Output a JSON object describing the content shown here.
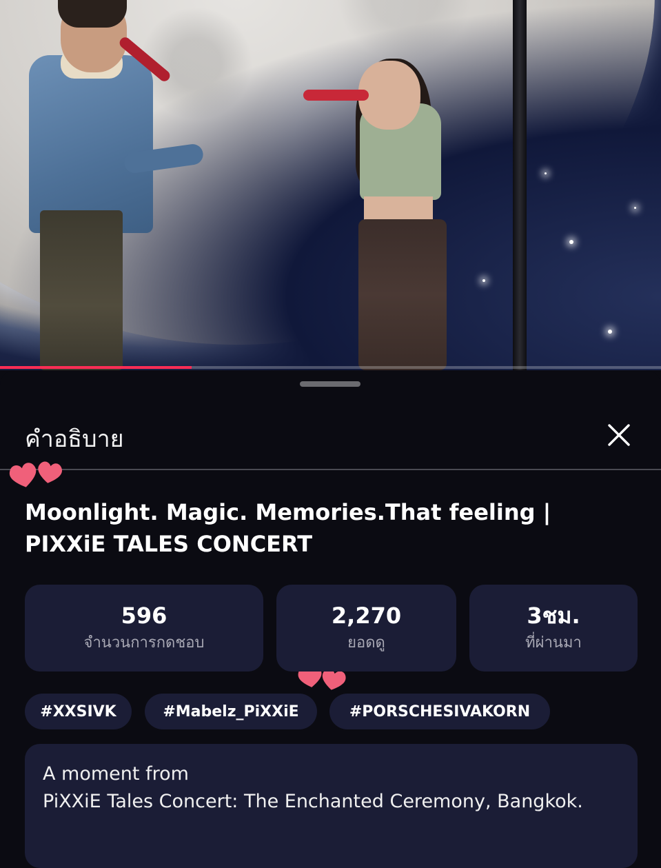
{
  "video": {
    "progress_fraction": 0.29,
    "accent_color": "#ff2d55"
  },
  "sheet": {
    "title": "คำอธิบาย",
    "close_icon": "close-icon",
    "video_title": "Moonlight. Magic. Memories.That feeling | PIXXiE TALES CONCERT"
  },
  "stats": [
    {
      "value": "596",
      "label": "จำนวนการกดชอบ"
    },
    {
      "value": "2,270",
      "label": "ยอดดู"
    },
    {
      "value": "3ชม.",
      "label": "ที่ผ่านมา"
    }
  ],
  "tags": [
    "#XXSIVK",
    "#Mabelz_PiXXiE",
    "#PORSCHESIVAKORN"
  ],
  "description": {
    "line1": "A moment from",
    "line2": "PiXXiE Tales Concert: The Enchanted Ceremony, Bangkok."
  },
  "colors": {
    "background": "#0b0b12",
    "card": "#1b1d36",
    "heart": "#f0607a"
  }
}
